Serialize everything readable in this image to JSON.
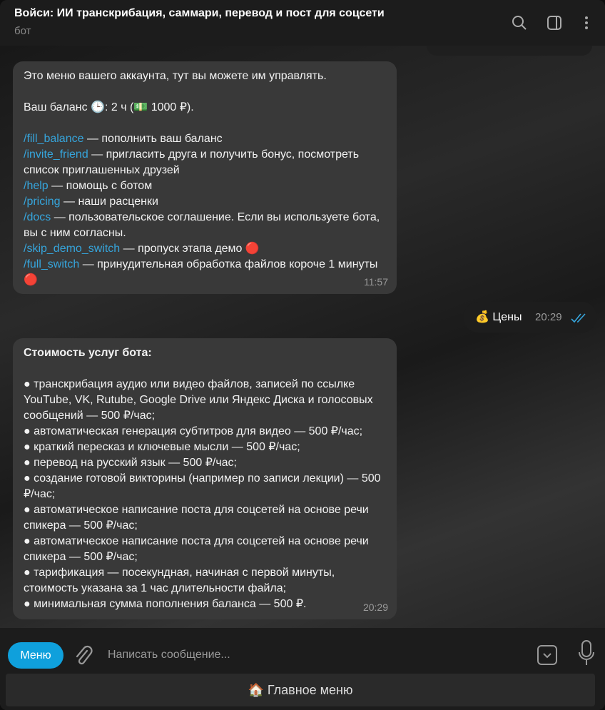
{
  "header": {
    "title": "Войси: ИИ транскрибация, саммари, перевод и пост для соцсети",
    "subtitle": "бот",
    "icons": [
      "search-icon",
      "sidebar-toggle-icon",
      "more-vertical-icon"
    ]
  },
  "messages": {
    "account": {
      "intro": "Это меню вашего аккаунта, тут вы можете им управлять.",
      "balance": "Ваш баланс 🕒: 2 ч (💵 1000 ₽).",
      "commands": [
        {
          "cmd": "/fill_balance",
          "desc": " — пополнить ваш баланс"
        },
        {
          "cmd": "/invite_friend",
          "desc": " — пригласить друга и получить бонус, посмотреть список приглашенных друзей"
        },
        {
          "cmd": "/help",
          "desc": " — помощь с ботом"
        },
        {
          "cmd": "/pricing",
          "desc": " — наши расценки"
        },
        {
          "cmd": "/docs",
          "desc": " — пользовательское соглашение. Если вы используете бота, вы с ним согласны."
        },
        {
          "cmd": "/skip_demo_switch",
          "desc": " — пропуск этапа демо 🔴"
        },
        {
          "cmd": "/full_switch",
          "desc": " — принудительная обработка файлов короче 1 минуты 🔴"
        }
      ],
      "time": "11:57"
    },
    "outgoing": {
      "text": "💰 Цены",
      "time": "20:29",
      "status": "read"
    },
    "pricing": {
      "heading": "Стоимость услуг бота:",
      "items": [
        "● транскрибация аудио или видео файлов, записей по ссылке YouTube, VK, Rutube, Google Drive или Яндекс Диска и голосовых сообщений  — 500 ₽/час;",
        "● автоматическая генерация субтитров для видео — 500 ₽/час;",
        "● краткий пересказ и ключевые мысли — 500 ₽/час;",
        "● перевод на русский язык — 500 ₽/час;",
        "● создание готовой викторины (например по записи лекции) — 500 ₽/час;",
        "● автоматическое написание поста для соцсетей на основе речи спикера — 500 ₽/час;",
        "● автоматическое написание поста для соцсетей на основе речи спикера — 500 ₽/час;",
        "● тарификация — посекундная, начиная с первой минуты, стоимость указана за 1 час длительности файла;",
        "● минимальная сумма пополнения баланса — 500 ₽."
      ],
      "time": "20:29"
    }
  },
  "composer": {
    "menu_label": "Меню",
    "placeholder": "Написать сообщение...",
    "keyboard_button": "🏠 Главное меню"
  },
  "colors": {
    "accent": "#0fa0dc",
    "link": "#36a5dc",
    "bubble": "#393939",
    "header": "#1c1c1c"
  }
}
